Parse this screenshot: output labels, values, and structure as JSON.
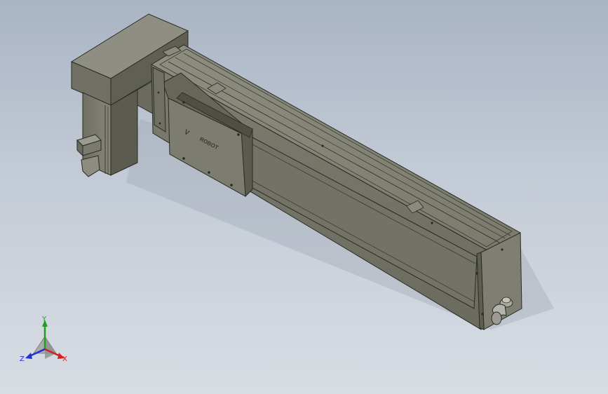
{
  "viewport": {
    "background_top": "#a9b4c4",
    "background_bottom": "#d8dde4"
  },
  "model": {
    "body_color": "#77776a",
    "body_light": "#8b8b7c",
    "body_dark": "#5a5a4e",
    "edge_color": "#2a2a24",
    "logo_text": "ROBOT"
  },
  "triad": {
    "x_label": "X",
    "y_label": "Y",
    "z_label": "Z",
    "x_color": "#d02020",
    "y_color": "#20a020",
    "z_color": "#2030d0"
  }
}
